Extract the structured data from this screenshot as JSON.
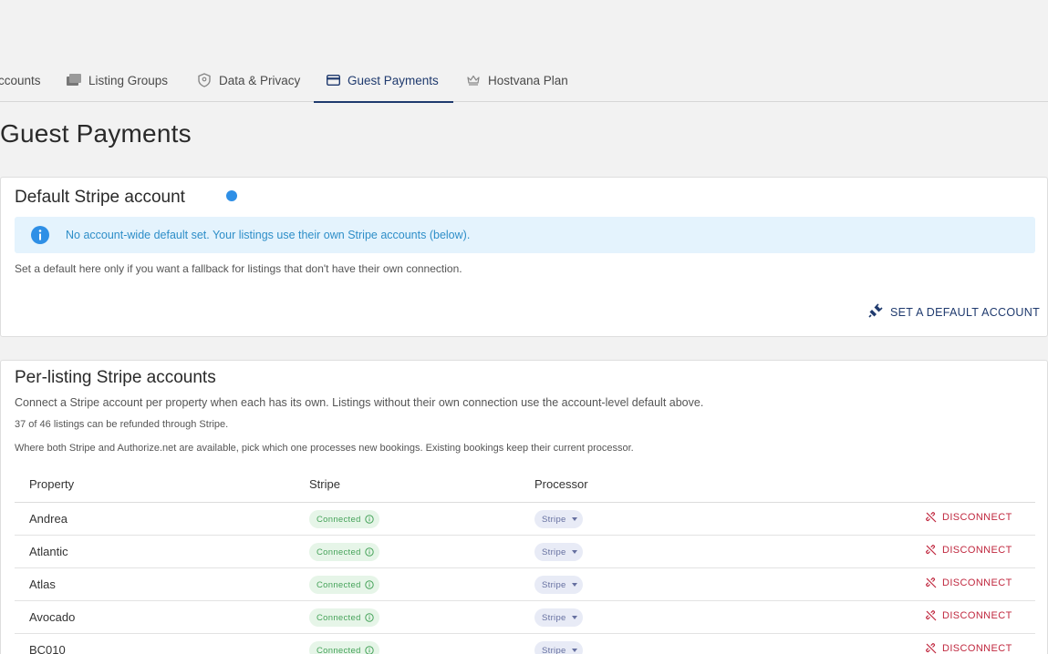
{
  "tabs": [
    {
      "label": "ccounts",
      "icon": "none"
    },
    {
      "label": "Listing Groups",
      "icon": "folders-icon"
    },
    {
      "label": "Data & Privacy",
      "icon": "shield-icon"
    },
    {
      "label": "Guest Payments",
      "icon": "card-icon",
      "active": true
    },
    {
      "label": "Hostvana Plan",
      "icon": "crown-icon"
    }
  ],
  "page": {
    "title": "Guest Payments"
  },
  "default_card": {
    "title": "Default Stripe account",
    "status_color": "#2e8fe6",
    "info_message": "No account-wide default set. Your listings use their own Stripe accounts (below).",
    "hint": "Set a default here only if you want a fallback for listings that don't have their own connection.",
    "action_label": "SET A DEFAULT ACCOUNT"
  },
  "listing_card": {
    "title": "Per-listing Stripe accounts",
    "description": "Connect a Stripe account per property when each has its own. Listings without their own connection use the account-level default above.",
    "refund_note": "37 of 46 listings can be refunded through Stripe.",
    "processor_note": "Where both Stripe and Authorize.net are available, pick which one processes new bookings. Existing bookings keep their current processor.",
    "columns": {
      "property": "Property",
      "stripe": "Stripe",
      "processor": "Processor"
    },
    "rows": [
      {
        "property": "Andrea",
        "status": "Connected",
        "processor": "Stripe",
        "action": "DISCONNECT"
      },
      {
        "property": "Atlantic",
        "status": "Connected",
        "processor": "Stripe",
        "action": "DISCONNECT"
      },
      {
        "property": "Atlas",
        "status": "Connected",
        "processor": "Stripe",
        "action": "DISCONNECT"
      },
      {
        "property": "Avocado",
        "status": "Connected",
        "processor": "Stripe",
        "action": "DISCONNECT"
      },
      {
        "property": "BC010",
        "status": "Connected",
        "processor": "Stripe",
        "action": "DISCONNECT"
      }
    ]
  },
  "colors": {
    "accent": "#1f3a6e",
    "connected": "#46a35a",
    "danger": "#c0283f",
    "info": "#2e8ec8"
  }
}
